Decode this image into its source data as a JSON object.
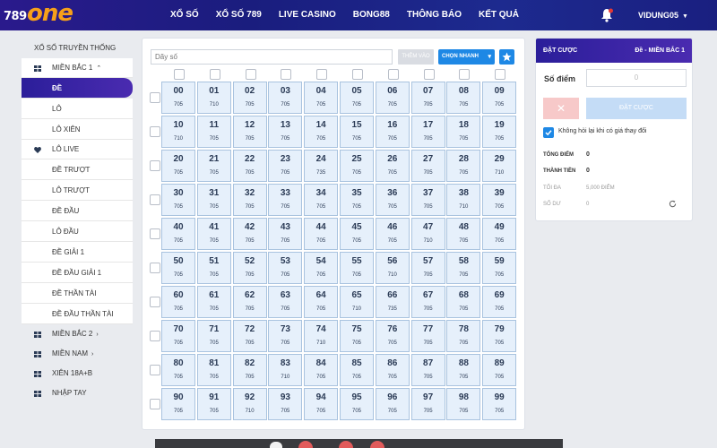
{
  "header": {
    "logo_number": "789",
    "logo_word": "one",
    "nav": [
      "XỔ SỐ",
      "XỔ SỐ 789",
      "LIVE CASINO",
      "BONG88",
      "THÔNG BÁO",
      "KẾT QUẢ"
    ],
    "username": "VIDUNG05"
  },
  "sidebar": {
    "title": "XỔ SỐ TRUYỀN THỐNG",
    "group_mien_bac_1": "MIỀN BẮC 1",
    "items_mb1": [
      "ĐỀ",
      "LÔ",
      "LÔ XIÊN"
    ],
    "lo_live": "LÔ LIVE",
    "items_live": [
      "ĐỀ TRƯỢT",
      "LÔ TRƯỢT",
      "ĐỀ ĐẦU",
      "LÔ ĐẦU",
      "ĐỀ GIẢI 1",
      "ĐỀ ĐẦU GIẢI 1",
      "ĐỀ THẦN TÀI",
      "ĐỀ ĐẦU THẦN TÀI"
    ],
    "group_mien_bac_2": "MIỀN BẮC 2",
    "group_mien_nam": "MIỀN NAM",
    "group_xien": "XIÊN 18A+B",
    "group_nhap_tay": "NHẬP TAY"
  },
  "board": {
    "input_placeholder": "Dãy số",
    "add_label": "THÊM VÀO",
    "quick_label": "CHỌN NHANH",
    "cells": [
      {
        "n": "00",
        "p": "705"
      },
      {
        "n": "01",
        "p": "710"
      },
      {
        "n": "02",
        "p": "705"
      },
      {
        "n": "03",
        "p": "705"
      },
      {
        "n": "04",
        "p": "705"
      },
      {
        "n": "05",
        "p": "705"
      },
      {
        "n": "06",
        "p": "705"
      },
      {
        "n": "07",
        "p": "705"
      },
      {
        "n": "08",
        "p": "705"
      },
      {
        "n": "09",
        "p": "705"
      },
      {
        "n": "10",
        "p": "710"
      },
      {
        "n": "11",
        "p": "705"
      },
      {
        "n": "12",
        "p": "705"
      },
      {
        "n": "13",
        "p": "705"
      },
      {
        "n": "14",
        "p": "705"
      },
      {
        "n": "15",
        "p": "705"
      },
      {
        "n": "16",
        "p": "705"
      },
      {
        "n": "17",
        "p": "705"
      },
      {
        "n": "18",
        "p": "705"
      },
      {
        "n": "19",
        "p": "705"
      },
      {
        "n": "20",
        "p": "705"
      },
      {
        "n": "21",
        "p": "705"
      },
      {
        "n": "22",
        "p": "705"
      },
      {
        "n": "23",
        "p": "705"
      },
      {
        "n": "24",
        "p": "735"
      },
      {
        "n": "25",
        "p": "705"
      },
      {
        "n": "26",
        "p": "705"
      },
      {
        "n": "27",
        "p": "705"
      },
      {
        "n": "28",
        "p": "705"
      },
      {
        "n": "29",
        "p": "710"
      },
      {
        "n": "30",
        "p": "705"
      },
      {
        "n": "31",
        "p": "705"
      },
      {
        "n": "32",
        "p": "705"
      },
      {
        "n": "33",
        "p": "705"
      },
      {
        "n": "34",
        "p": "705"
      },
      {
        "n": "35",
        "p": "705"
      },
      {
        "n": "36",
        "p": "705"
      },
      {
        "n": "37",
        "p": "705"
      },
      {
        "n": "38",
        "p": "710"
      },
      {
        "n": "39",
        "p": "705"
      },
      {
        "n": "40",
        "p": "705"
      },
      {
        "n": "41",
        "p": "705"
      },
      {
        "n": "42",
        "p": "705"
      },
      {
        "n": "43",
        "p": "705"
      },
      {
        "n": "44",
        "p": "705"
      },
      {
        "n": "45",
        "p": "705"
      },
      {
        "n": "46",
        "p": "705"
      },
      {
        "n": "47",
        "p": "710"
      },
      {
        "n": "48",
        "p": "705"
      },
      {
        "n": "49",
        "p": "705"
      },
      {
        "n": "50",
        "p": "705"
      },
      {
        "n": "51",
        "p": "705"
      },
      {
        "n": "52",
        "p": "705"
      },
      {
        "n": "53",
        "p": "705"
      },
      {
        "n": "54",
        "p": "705"
      },
      {
        "n": "55",
        "p": "705"
      },
      {
        "n": "56",
        "p": "710"
      },
      {
        "n": "57",
        "p": "705"
      },
      {
        "n": "58",
        "p": "705"
      },
      {
        "n": "59",
        "p": "705"
      },
      {
        "n": "60",
        "p": "705"
      },
      {
        "n": "61",
        "p": "705"
      },
      {
        "n": "62",
        "p": "705"
      },
      {
        "n": "63",
        "p": "705"
      },
      {
        "n": "64",
        "p": "705"
      },
      {
        "n": "65",
        "p": "710"
      },
      {
        "n": "66",
        "p": "735"
      },
      {
        "n": "67",
        "p": "705"
      },
      {
        "n": "68",
        "p": "705"
      },
      {
        "n": "69",
        "p": "705"
      },
      {
        "n": "70",
        "p": "705"
      },
      {
        "n": "71",
        "p": "705"
      },
      {
        "n": "72",
        "p": "705"
      },
      {
        "n": "73",
        "p": "705"
      },
      {
        "n": "74",
        "p": "710"
      },
      {
        "n": "75",
        "p": "705"
      },
      {
        "n": "76",
        "p": "705"
      },
      {
        "n": "77",
        "p": "705"
      },
      {
        "n": "78",
        "p": "705"
      },
      {
        "n": "79",
        "p": "705"
      },
      {
        "n": "80",
        "p": "705"
      },
      {
        "n": "81",
        "p": "705"
      },
      {
        "n": "82",
        "p": "705"
      },
      {
        "n": "83",
        "p": "710"
      },
      {
        "n": "84",
        "p": "705"
      },
      {
        "n": "85",
        "p": "705"
      },
      {
        "n": "86",
        "p": "705"
      },
      {
        "n": "87",
        "p": "705"
      },
      {
        "n": "88",
        "p": "705"
      },
      {
        "n": "89",
        "p": "705"
      },
      {
        "n": "90",
        "p": "705"
      },
      {
        "n": "91",
        "p": "705"
      },
      {
        "n": "92",
        "p": "710"
      },
      {
        "n": "93",
        "p": "705"
      },
      {
        "n": "94",
        "p": "705"
      },
      {
        "n": "95",
        "p": "705"
      },
      {
        "n": "96",
        "p": "705"
      },
      {
        "n": "97",
        "p": "705"
      },
      {
        "n": "98",
        "p": "705"
      },
      {
        "n": "99",
        "p": "705"
      }
    ]
  },
  "bet": {
    "title": "ĐẶT CƯỢC",
    "subtitle": "Đề - MIỀN BẮC 1",
    "points_label": "Số điểm",
    "points_value": "0",
    "place_label": "ĐẶT CƯỢC",
    "ask_label": "Không hỏi lại khi có giá thay đổi",
    "total_points_label": "TỔNG ĐIỂM",
    "total_points_value": "0",
    "amount_label": "THÀNH TIỀN",
    "amount_value": "0",
    "max_label": "TỐI ĐA",
    "max_value": "5,000 ĐIỂM",
    "balance_label": "SỐ DƯ",
    "balance_value": "0"
  },
  "colors": {
    "brand": "#2b1e9a",
    "accent": "#1e88e5",
    "logo": "#f6a01a",
    "cell_bg": "#e6f0fb"
  }
}
